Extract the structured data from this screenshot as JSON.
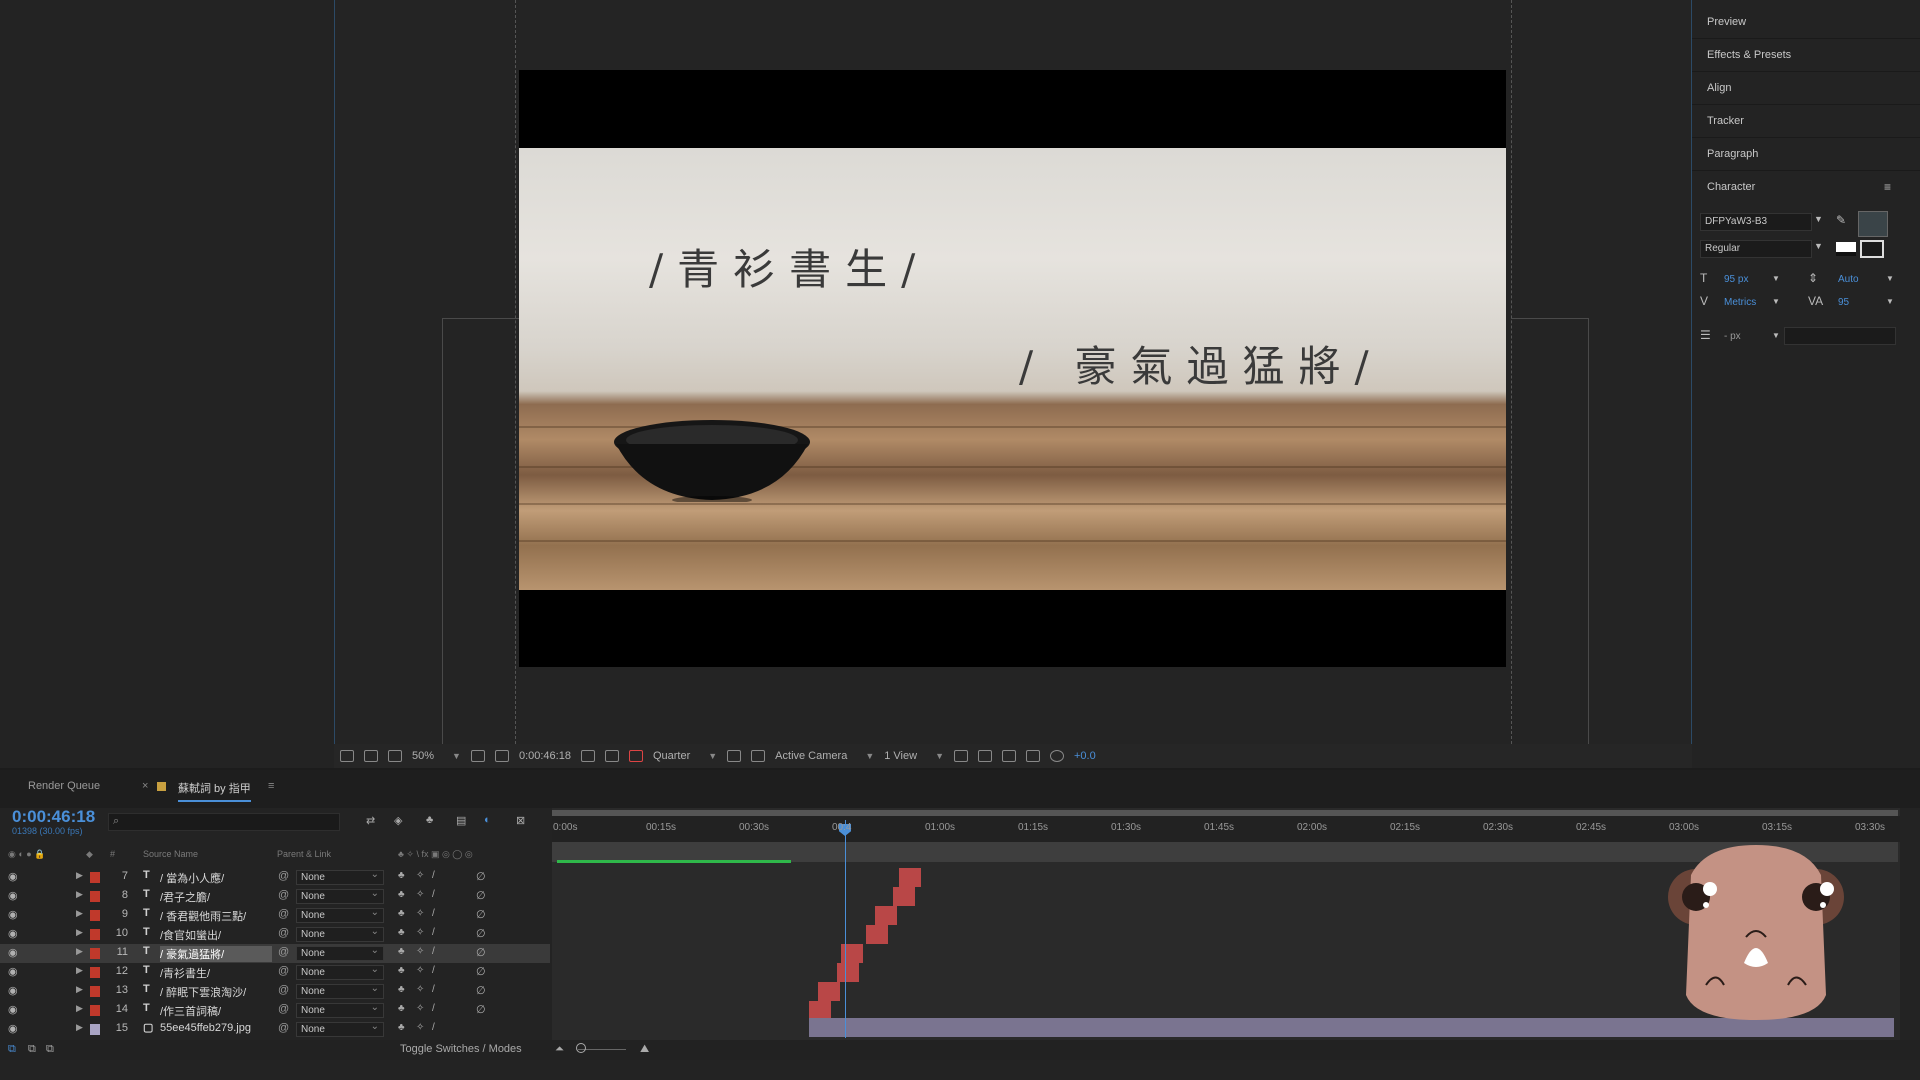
{
  "viewer": {
    "comp_text_1": "/青衫書生/",
    "comp_text_2": "/ 豪氣過猛將/",
    "zoom": "50%",
    "timecode": "0:00:46:18",
    "resolution": "Quarter",
    "camera": "Active Camera",
    "views": "1 View",
    "exposure": "+0.0"
  },
  "right_panel": {
    "items": [
      "Preview",
      "Effects & Presets",
      "Align",
      "Tracker",
      "Paragraph",
      "Character"
    ],
    "font_family": "DFPYaW3-B3",
    "font_style": "Regular",
    "font_size": "95 px",
    "leading": "Auto",
    "kerning": "Metrics",
    "tracking": "95",
    "stroke_width": "- px"
  },
  "timeline": {
    "tab_render_queue": "Render Queue",
    "tab_comp": "蘇軾詞 by 指甲",
    "timecode": "0:00:46:18",
    "timecode_sub": "01398 (30.00 fps)",
    "col_source_name": "Source Name",
    "col_parent": "Parent & Link",
    "ruler": [
      "0:00s",
      "00:15s",
      "00:30s",
      "00:4",
      "01:00s",
      "01:15s",
      "01:30s",
      "01:45s",
      "02:00s",
      "02:15s",
      "02:30s",
      "02:45s",
      "03:00s",
      "03:15s",
      "03:30s"
    ],
    "layers": [
      {
        "idx": "7",
        "type": "T",
        "name": "/ 當為小人應/",
        "parent": "None"
      },
      {
        "idx": "8",
        "type": "T",
        "name": "/君子之膽/",
        "parent": "None"
      },
      {
        "idx": "9",
        "type": "T",
        "name": "/ 香君觀他雨三點/",
        "parent": "None"
      },
      {
        "idx": "10",
        "type": "T",
        "name": "/食官如蠻出/",
        "parent": "None"
      },
      {
        "idx": "11",
        "type": "T",
        "name": "/ 豪氣過猛將/",
        "parent": "None"
      },
      {
        "idx": "12",
        "type": "T",
        "name": "/青衫書生/",
        "parent": "None"
      },
      {
        "idx": "13",
        "type": "T",
        "name": "/ 醉眠下雲浪淘沙/",
        "parent": "None"
      },
      {
        "idx": "14",
        "type": "T",
        "name": "/作三首詞稿/",
        "parent": "None"
      },
      {
        "idx": "15",
        "type": "",
        "name": "55ee45ffeb279.jpg",
        "parent": "None"
      }
    ],
    "toggle_label": "Toggle Switches / Modes"
  },
  "colors": {
    "accent_blue": "#4a8fd8",
    "label_red": "#c0392b",
    "bar_red": "#c94a4a"
  }
}
